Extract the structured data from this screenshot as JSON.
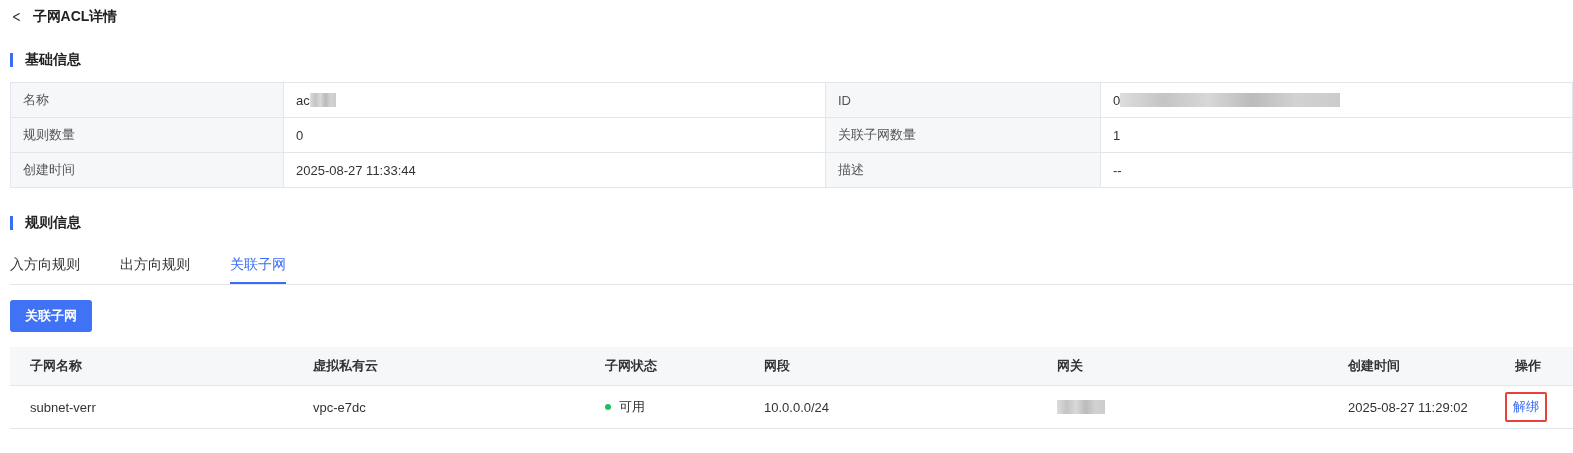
{
  "header": {
    "back": "<",
    "title": "子网ACL详情"
  },
  "basic_section": {
    "title": "基础信息"
  },
  "basic_info": [
    {
      "label": "名称",
      "value": "ac",
      "redacted": true
    },
    {
      "label": "ID",
      "value": "0",
      "redacted": true
    },
    {
      "label": "规则数量",
      "value": "0",
      "redacted": false
    },
    {
      "label": "关联子网数量",
      "value": "1",
      "redacted": false
    },
    {
      "label": "创建时间",
      "value": "2025-08-27 11:33:44",
      "redacted": false
    },
    {
      "label": "描述",
      "value": "--",
      "redacted": false
    }
  ],
  "rules_section": {
    "title": "规则信息"
  },
  "tabs": [
    {
      "label": "入方向规则",
      "selected": false
    },
    {
      "label": "出方向规则",
      "selected": false
    },
    {
      "label": "关联子网",
      "selected": true
    }
  ],
  "primary_button": "关联子网",
  "table": {
    "columns": [
      "子网名称",
      "虚拟私有云",
      "子网状态",
      "网段",
      "网关",
      "创建时间",
      "操作"
    ],
    "rows": [
      {
        "name": "subnet-verr",
        "vpc": "vpc-e7dc",
        "status": {
          "text": "可用",
          "color": "#1dbf60"
        },
        "cidr": "10.0.0.0/24",
        "gateway_redacted": true,
        "created": "2025-08-27 11:29:02",
        "action": {
          "label": "解绑",
          "highlighted": true
        }
      }
    ]
  }
}
